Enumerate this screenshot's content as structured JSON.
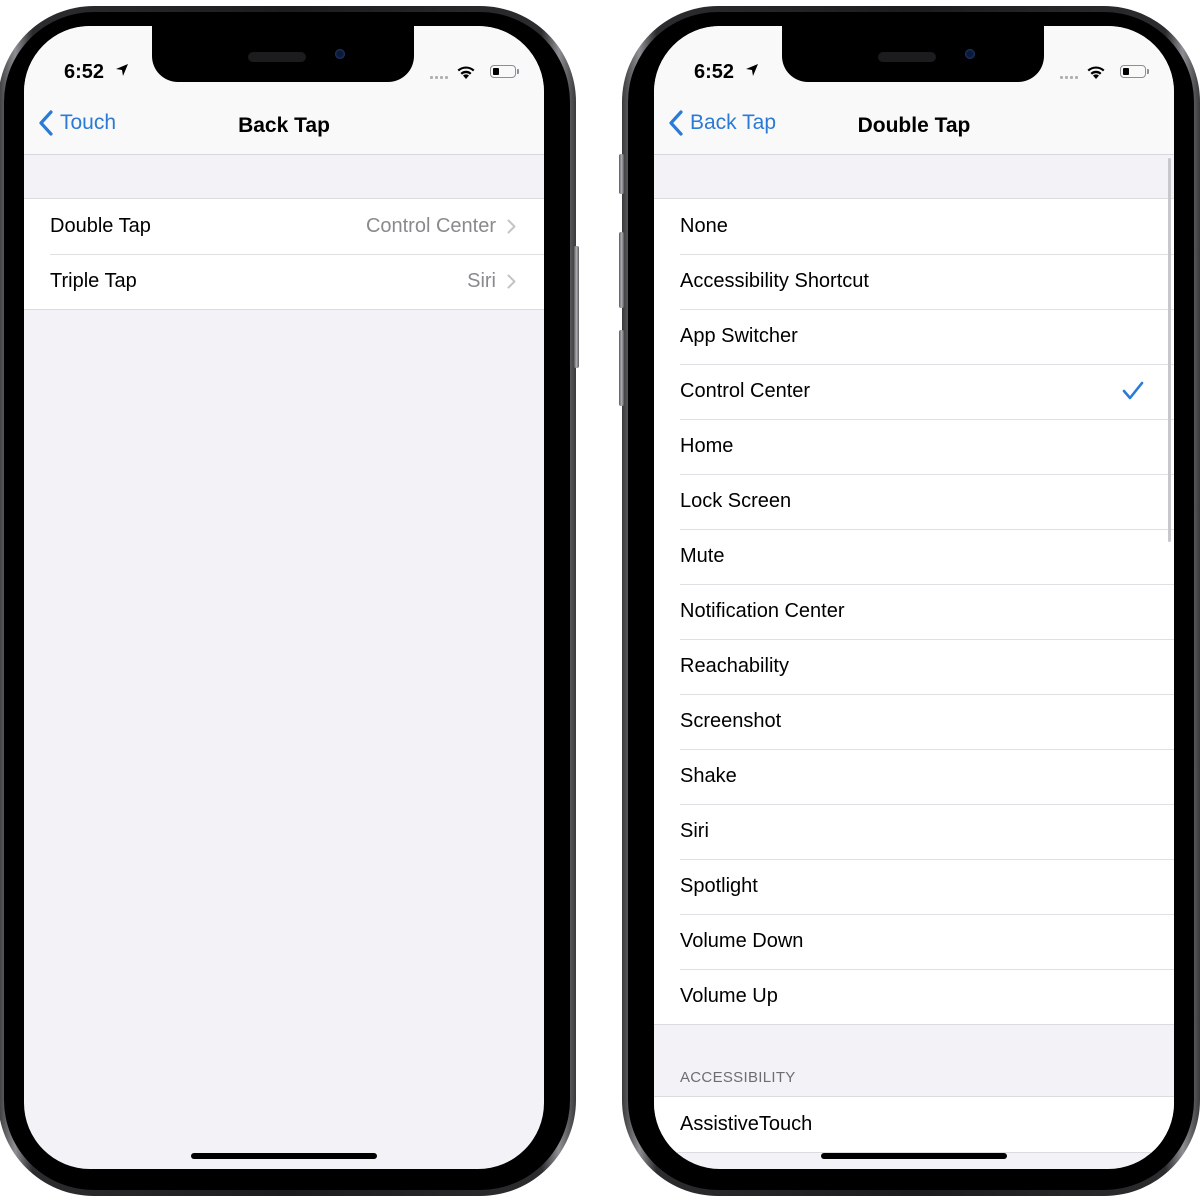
{
  "theme": {
    "accent": "#2a7ad6",
    "background": "#f2f2f7",
    "cell": "#ffffff",
    "secondary_text": "#8a8a8e"
  },
  "left_phone": {
    "status": {
      "time": "6:52",
      "location_icon": "location-arrow-icon",
      "wifi_icon": "wifi-icon",
      "battery_icon": "battery-low-icon"
    },
    "nav": {
      "back_label": "Touch",
      "title": "Back Tap"
    },
    "rows": [
      {
        "label": "Double Tap",
        "value": "Control Center"
      },
      {
        "label": "Triple Tap",
        "value": "Siri"
      }
    ]
  },
  "right_phone": {
    "status": {
      "time": "6:52",
      "location_icon": "location-arrow-icon",
      "wifi_icon": "wifi-icon",
      "battery_icon": "battery-low-icon"
    },
    "nav": {
      "back_label": "Back Tap",
      "title": "Double Tap"
    },
    "actions": [
      {
        "label": "None",
        "selected": false
      },
      {
        "label": "Accessibility Shortcut",
        "selected": false
      },
      {
        "label": "App Switcher",
        "selected": false
      },
      {
        "label": "Control Center",
        "selected": true
      },
      {
        "label": "Home",
        "selected": false
      },
      {
        "label": "Lock Screen",
        "selected": false
      },
      {
        "label": "Mute",
        "selected": false
      },
      {
        "label": "Notification Center",
        "selected": false
      },
      {
        "label": "Reachability",
        "selected": false
      },
      {
        "label": "Screenshot",
        "selected": false
      },
      {
        "label": "Shake",
        "selected": false
      },
      {
        "label": "Siri",
        "selected": false
      },
      {
        "label": "Spotlight",
        "selected": false
      },
      {
        "label": "Volume Down",
        "selected": false
      },
      {
        "label": "Volume Up",
        "selected": false
      }
    ],
    "accessibility_section": {
      "header": "ACCESSIBILITY",
      "items": [
        {
          "label": "AssistiveTouch"
        }
      ]
    }
  }
}
